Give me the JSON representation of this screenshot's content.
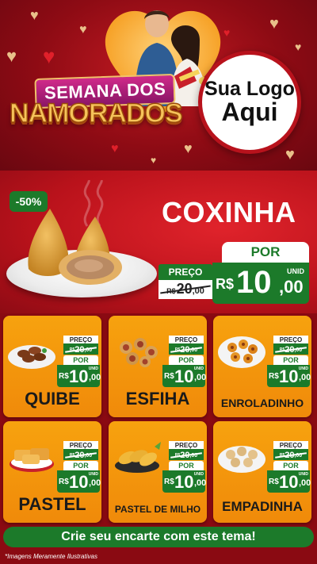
{
  "hero": {
    "title_line1": "SEMANA DOS",
    "title_line2": "NAMORADOS",
    "logo_line1": "Sua Logo",
    "logo_line2": "Aqui"
  },
  "featured": {
    "discount": "-50%",
    "name": "COXINHA",
    "preco_label": "PREÇO",
    "old_currency": "R$",
    "old_int": "20",
    "old_dec": ",00",
    "por_label": "POR",
    "unid_label": "UNID",
    "new_currency": "R$",
    "new_int": "10",
    "new_dec": ",00"
  },
  "products": [
    {
      "name": "QUIBE",
      "preco_label": "PREÇO",
      "old_currency": "R$",
      "old_int": "20",
      "old_dec": ",00",
      "por_label": "POR",
      "unid_label": "UNID",
      "new_currency": "R$",
      "new_int": "10",
      "new_dec": ",00"
    },
    {
      "name": "ESFIHA",
      "preco_label": "PREÇO",
      "old_currency": "R$",
      "old_int": "20",
      "old_dec": ",00",
      "por_label": "POR",
      "unid_label": "UNID",
      "new_currency": "R$",
      "new_int": "10",
      "new_dec": ",00"
    },
    {
      "name": "ENROLADINHO",
      "preco_label": "PREÇO",
      "old_currency": "R$",
      "old_int": "20",
      "old_dec": ",00",
      "por_label": "POR",
      "unid_label": "UNID",
      "new_currency": "R$",
      "new_int": "10",
      "new_dec": ",00"
    },
    {
      "name": "PASTEL",
      "preco_label": "PREÇO",
      "old_currency": "R$",
      "old_int": "20",
      "old_dec": ",00",
      "por_label": "POR",
      "unid_label": "UNID",
      "new_currency": "R$",
      "new_int": "10",
      "new_dec": ",00"
    },
    {
      "name": "PASTEL DE MILHO",
      "preco_label": "PREÇO",
      "old_currency": "R$",
      "old_int": "20",
      "old_dec": ",00",
      "por_label": "POR",
      "unid_label": "UNID",
      "new_currency": "R$",
      "new_int": "10",
      "new_dec": ",00"
    },
    {
      "name": "EMPADINHA",
      "preco_label": "PREÇO",
      "old_currency": "R$",
      "old_int": "20",
      "old_dec": ",00",
      "por_label": "POR",
      "unid_label": "UNID",
      "new_currency": "R$",
      "new_int": "10",
      "new_dec": ",00"
    }
  ],
  "cta": "Crie seu encarte com este tema!",
  "footnote": "*Imagens Meramente Ilustrativas",
  "colors": {
    "brand_red": "#b9121b",
    "dark_red": "#8a0a12",
    "price_green": "#1c7a2a",
    "card_orange": "#f7a20e",
    "gold": "#f6c35a"
  },
  "icons": {
    "hero_image": "couple-photo",
    "featured_image": "coxinha-photo",
    "product_images": [
      "quibe-photo",
      "esfiha-photo",
      "enroladinho-photo",
      "pastel-photo",
      "pastel-de-milho-photo",
      "empadinha-photo"
    ]
  }
}
